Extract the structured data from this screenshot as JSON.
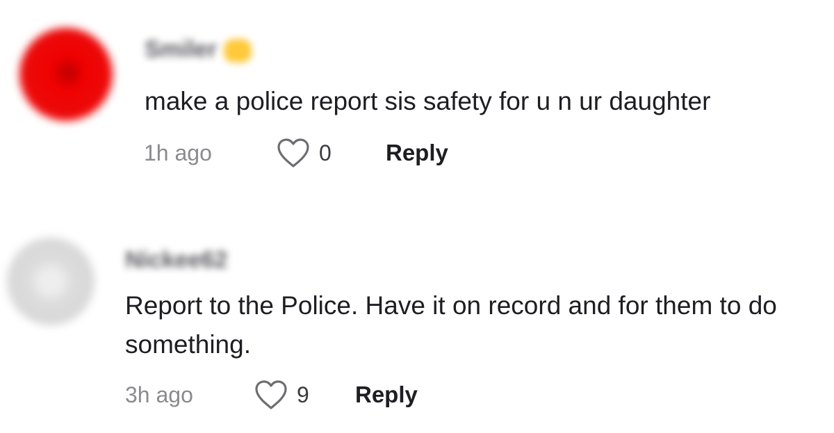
{
  "comments": [
    {
      "username": "Smiler",
      "text": "make a police report sis safety for u n ur daughter",
      "time": "1h ago",
      "likes": "0",
      "reply_label": "Reply",
      "avatar_color": "#ee1111",
      "badge_color": "#ffc93a"
    },
    {
      "username": "Nickee62",
      "text": "Report to the Police. Have it on record and for them to do something.",
      "time": "3h ago",
      "likes": "9",
      "reply_label": "Reply",
      "avatar_color": "#d6d6d6"
    }
  ],
  "icons": {
    "like": "heart-outline-icon"
  }
}
